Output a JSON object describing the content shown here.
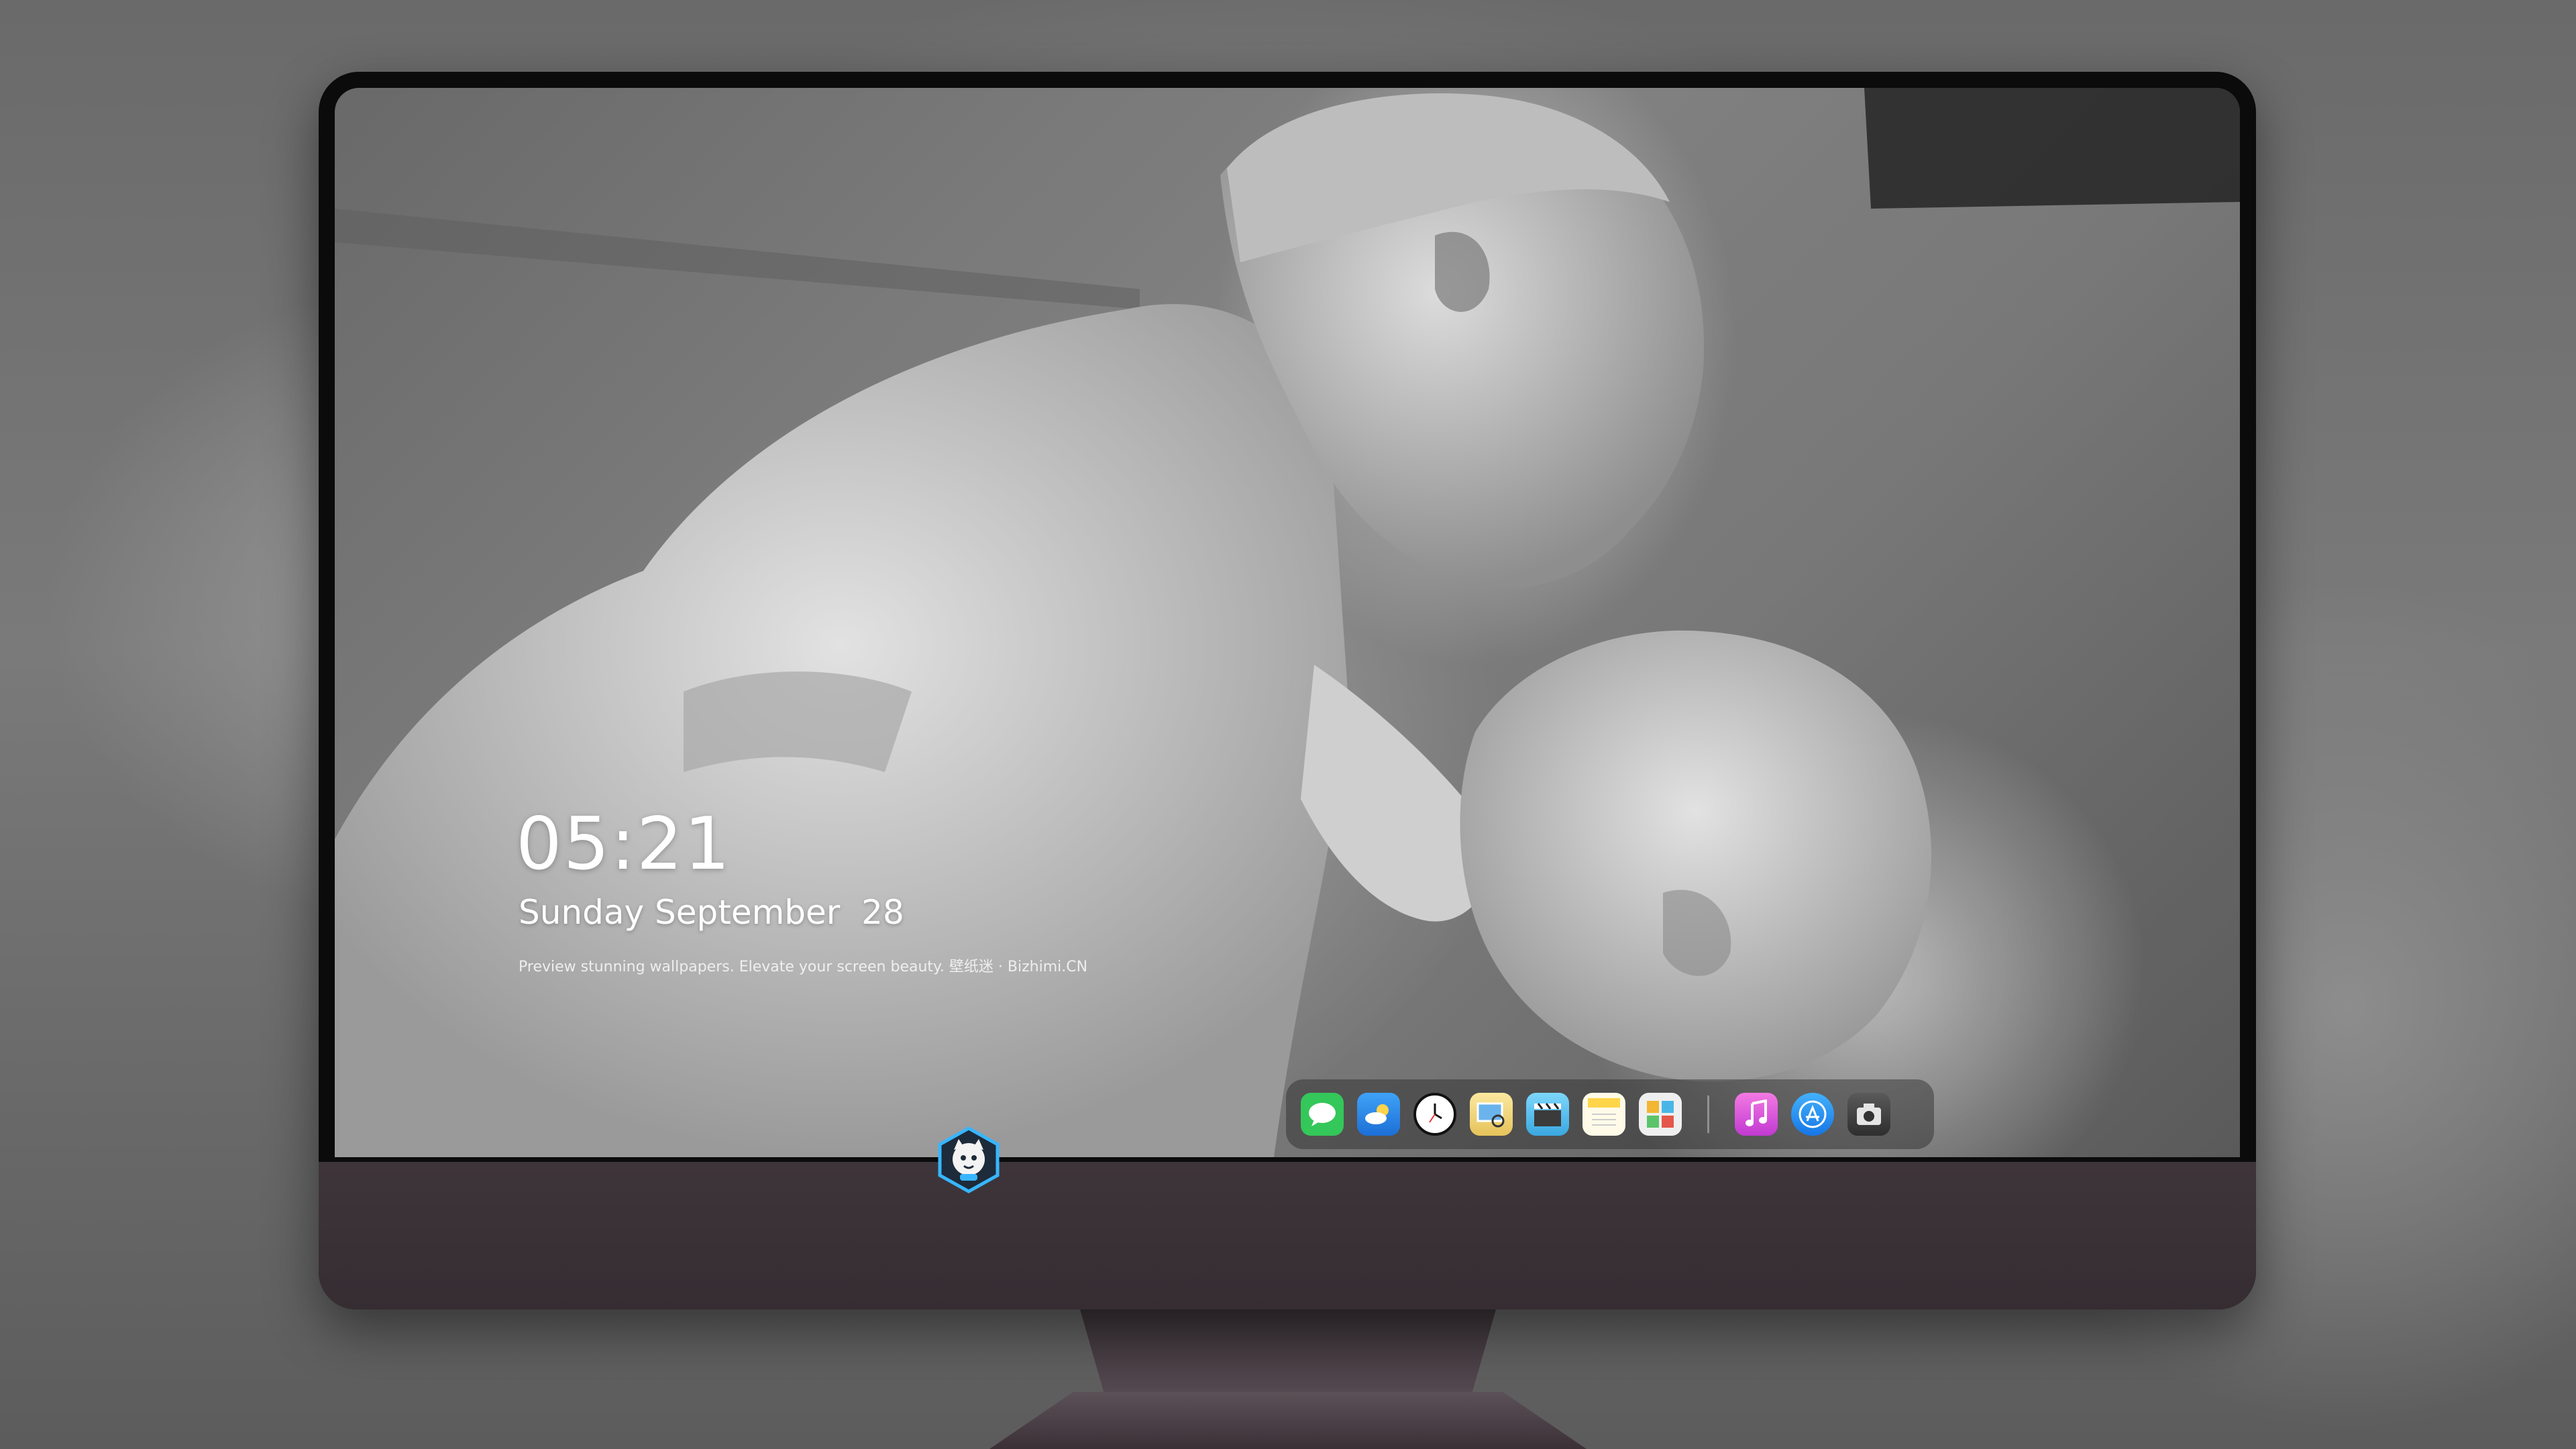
{
  "lockscreen": {
    "time": "05:21",
    "date": "Sunday September  28",
    "caption": "Preview stunning wallpapers. Elevate your screen beauty. 壁纸迷 · Bizhimi.CN"
  },
  "dock": {
    "apps": [
      {
        "name": "messages-icon",
        "color": "#34c759"
      },
      {
        "name": "weather-icon",
        "color": "#2f8ff0"
      },
      {
        "name": "clock-icon",
        "color": "#111111"
      },
      {
        "name": "preview-icon",
        "color": "#f3d36b"
      },
      {
        "name": "final-cut-icon",
        "color": "#5bc8f5"
      },
      {
        "name": "notes-icon",
        "color": "#ffd54a"
      },
      {
        "name": "photo-booth-icon",
        "color": "#e9e9e9"
      },
      {
        "name": "itunes-icon",
        "color": "#e85bd8"
      },
      {
        "name": "app-store-icon",
        "color": "#1d8cf8"
      },
      {
        "name": "screenshot-icon",
        "color": "#3c3c3c"
      }
    ]
  },
  "brand": {
    "name": "mascot-logo-icon",
    "accent": "#37b6ff"
  }
}
